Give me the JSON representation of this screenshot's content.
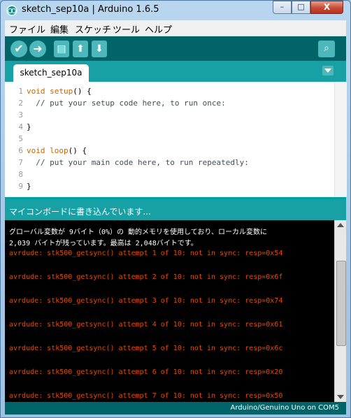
{
  "window": {
    "title": "sketch_sep10a | Arduino 1.6.5",
    "controls": {
      "minimize": "–",
      "maximize": "□",
      "close": "X"
    }
  },
  "menu": [
    "ファイル",
    "編集",
    "スケッチ",
    "ツール",
    "ヘルプ"
  ],
  "toolbar": {
    "verify_icon": "✔",
    "upload_icon": "➜",
    "new_icon": "▤",
    "open_icon": "⬆",
    "save_icon": "⬇",
    "serial_icon": "⌕"
  },
  "tabs": [
    {
      "label": "sketch_sep10a"
    }
  ],
  "editor": {
    "line_numbers": [
      "1",
      "2",
      "3",
      "4",
      "5",
      "6",
      "7",
      "8",
      "9"
    ],
    "lines": [
      {
        "kw": "void",
        "fn": "setup",
        "rest": "() {"
      },
      {
        "text": "  // put your setup code here, to run once:"
      },
      {
        "text": ""
      },
      {
        "text": "}"
      },
      {
        "text": ""
      },
      {
        "kw": "void",
        "fn": "loop",
        "rest": "() {"
      },
      {
        "text": "  // put your main code here, to run repeatedly:"
      },
      {
        "text": ""
      },
      {
        "text": "}"
      }
    ]
  },
  "status": {
    "message": "マイコンボードに書き込んでいます..."
  },
  "console": {
    "info_lines": [
      "グローバル変数が 9バイト（0%）の 動的メモリを使用しており、ローカル変数に",
      "2,039 バイトが残っています。最高は 2,048バイトです。"
    ],
    "error_lines": [
      "avrdude: stk500_getsync() attempt 1 of 10: not in sync: resp=0x54",
      "avrdude: stk500_getsync() attempt 2 of 10: not in sync: resp=0x6f",
      "avrdude: stk500_getsync() attempt 3 of 10: not in sync: resp=0x74",
      "avrdude: stk500_getsync() attempt 4 of 10: not in sync: resp=0x61",
      "avrdude: stk500_getsync() attempt 5 of 10: not in sync: resp=0x6c",
      "avrdude: stk500_getsync() attempt 6 of 10: not in sync: resp=0x20",
      "avrdude: stk500_getsync() attempt 7 of 10: not in sync: resp=0x50"
    ]
  },
  "footer": {
    "board_port": "Arduino/Genuino Uno on COM5"
  },
  "colors": {
    "teal_dark": "#006468",
    "teal": "#17a1a5",
    "button": "#4db7bb",
    "error_text": "#e34c00"
  }
}
